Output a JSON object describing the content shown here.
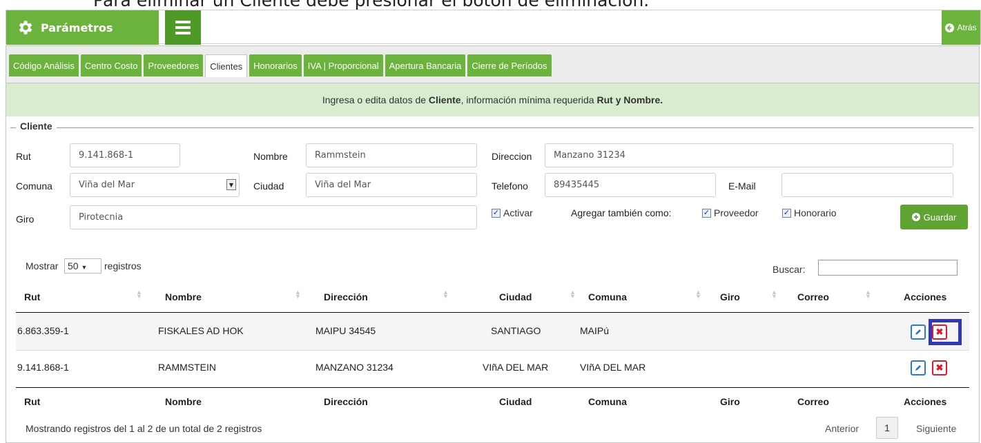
{
  "caption": "Para eliminar un Cliente debe presionar el botón de eliminación.",
  "topbar": {
    "title": "Parámetros",
    "back": "Atrás"
  },
  "tabs": [
    "Código Análisis",
    "Centro Costo",
    "Proveedores",
    "Clientes",
    "Honorarios",
    "IVA | Proporcional",
    "Apertura Bancaria",
    "Cierre de Períodos"
  ],
  "active_tab": "Clientes",
  "info": {
    "pre": "Ingresa o edita datos de ",
    "entity": "Cliente",
    "mid": ", información mínima requerida ",
    "req": "Rut y Nombre."
  },
  "form": {
    "legend": "Cliente",
    "rut_label": "Rut",
    "rut": "9.141.868-1",
    "nombre_label": "Nombre",
    "nombre": "Rammstein",
    "direccion_label": "Direccion",
    "direccion": "Manzano 31234",
    "comuna_label": "Comuna",
    "comuna": "Viña del Mar",
    "ciudad_label": "Ciudad",
    "ciudad": "Viña del Mar",
    "telefono_label": "Telefono",
    "telefono": "89435445",
    "email_label": "E-Mail",
    "email": "",
    "giro_label": "Giro",
    "giro": "Pirotecnia",
    "activar_label": "Activar",
    "agregar_label": "Agregar también como:",
    "proveedor_label": "Proveedor",
    "honorario_label": "Honorario",
    "guardar_label": "Guardar"
  },
  "table": {
    "show_label": "Mostrar",
    "show_value": "50",
    "records_label": "registros",
    "search_label": "Buscar:",
    "columns": [
      "Rut",
      "Nombre",
      "Dirección",
      "Ciudad",
      "Comuna",
      "Giro",
      "Correo",
      "Acciones"
    ],
    "rows": [
      {
        "rut": "6.863.359-1",
        "nombre": "FISKALES AD HOK",
        "direccion": "MAIPU 34545",
        "ciudad": "SANTIAGO",
        "comuna": "MAIPú",
        "giro": "",
        "correo": ""
      },
      {
        "rut": "9.141.868-1",
        "nombre": "RAMMSTEIN",
        "direccion": "MANZANO 31234",
        "ciudad": "VIñA DEL MAR",
        "comuna": "VIñA DEL MAR",
        "giro": "",
        "correo": ""
      }
    ],
    "footer_info": "Mostrando registros del 1 al 2 de un total de 2 registros",
    "prev": "Anterior",
    "page": "1",
    "next": "Siguiente"
  },
  "colors": {
    "green": "#6cb33e",
    "dark_green": "#4e9a26",
    "highlight": "#3237b6",
    "delete": "#e0192b",
    "edit": "#2a7ad5"
  }
}
